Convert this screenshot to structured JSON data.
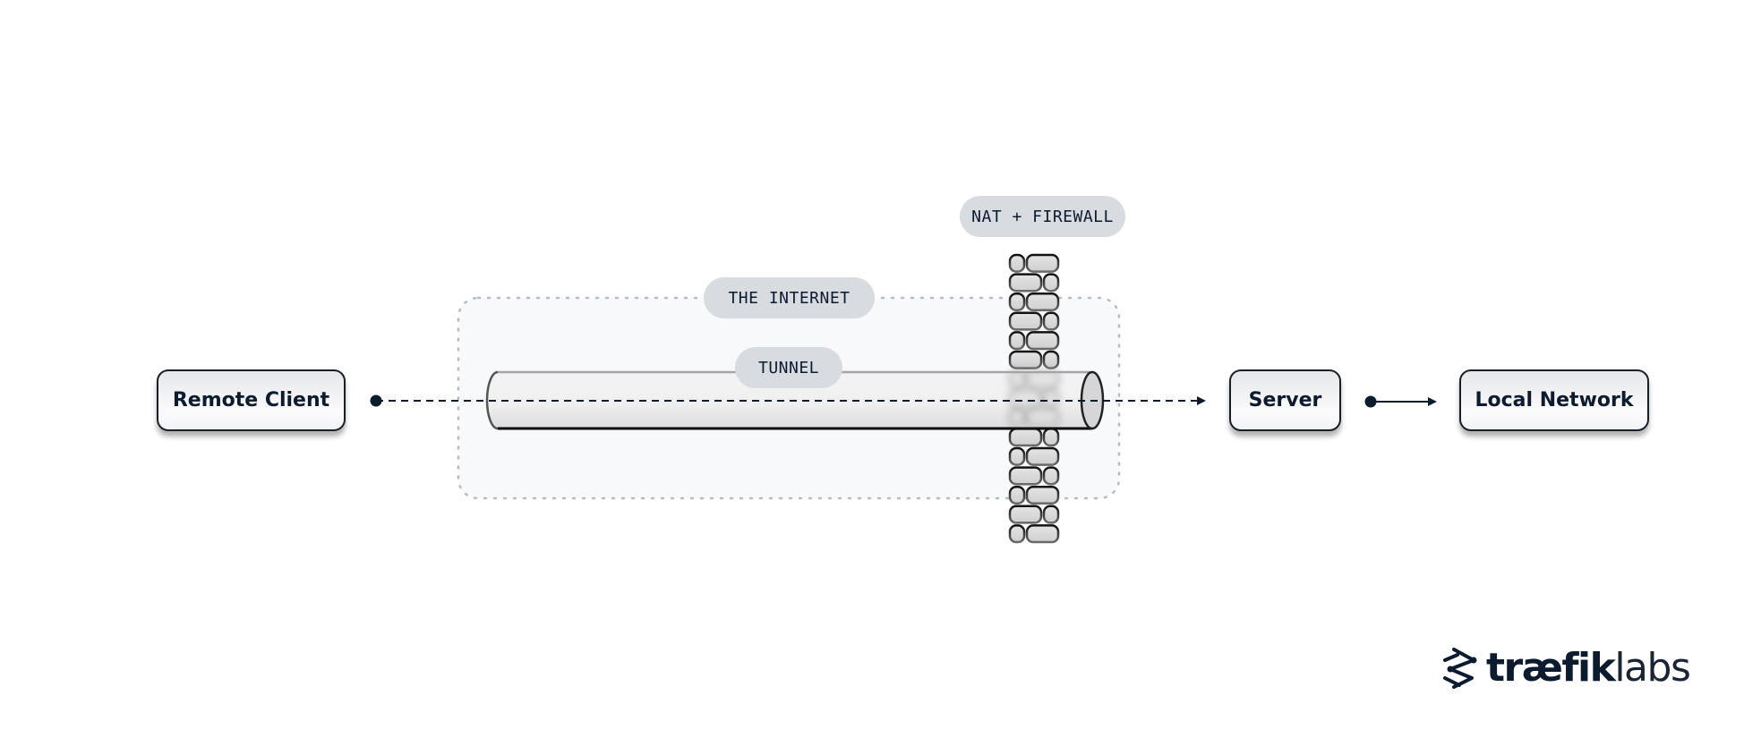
{
  "diagram": {
    "nodes": {
      "remote_client": "Remote Client",
      "server": "Server",
      "local_network": "Local Network"
    },
    "labels": {
      "internet": "THE INTERNET",
      "tunnel": "TUNNEL",
      "firewall": "NAT + FIREWALL"
    },
    "edges": [
      {
        "from": "remote_client",
        "to": "server",
        "style": "dashed",
        "via": "tunnel"
      },
      {
        "from": "server",
        "to": "local_network",
        "style": "solid"
      }
    ],
    "colors": {
      "ink": "#0d1b2e",
      "pill": "#d8dbe0",
      "region_fill": "#f8f9fb",
      "region_border": "#b8bcc2"
    }
  },
  "logo": {
    "brand_bold": "træfik",
    "brand_light": "labs"
  }
}
